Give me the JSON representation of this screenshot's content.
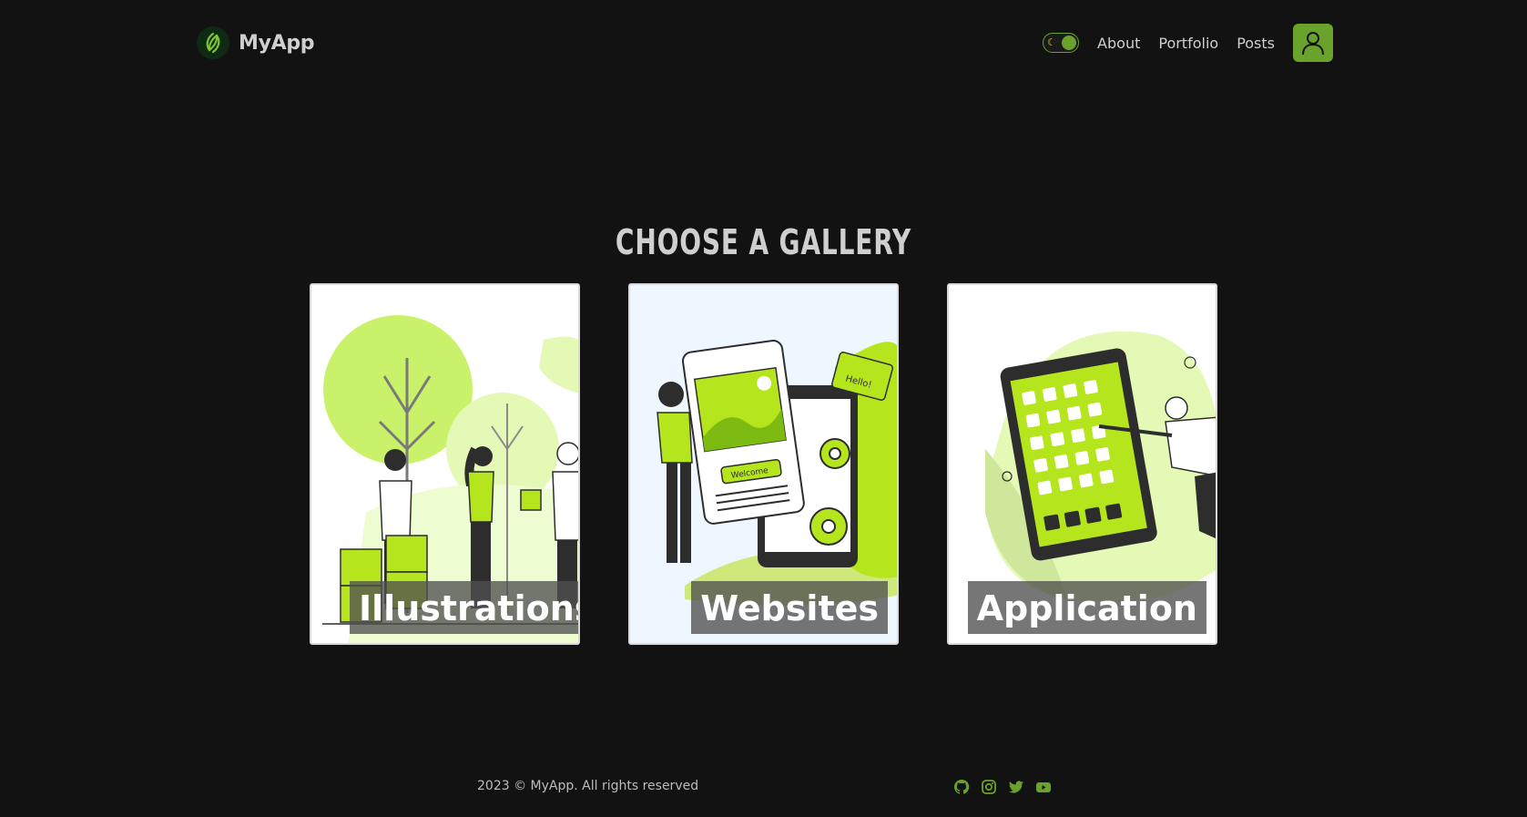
{
  "brand": {
    "name": "MyApp"
  },
  "nav": {
    "theme_toggle_icon": "moon-icon",
    "links": [
      "About",
      "Portfolio",
      "Posts"
    ],
    "user_icon": "user-icon"
  },
  "main": {
    "title": "CHOOSE A GALLERY",
    "cards": [
      {
        "label": "Illustrations",
        "illustration": "people-with-trees-and-boxes"
      },
      {
        "label": "Websites",
        "illustration": "woman-with-phone-and-gears"
      },
      {
        "label": "Application",
        "illustration": "man-tapping-tablet-apps"
      }
    ]
  },
  "footer": {
    "copyright": "2023 © MyApp. All rights reserved",
    "socials": [
      "github-icon",
      "instagram-icon",
      "twitter-icon",
      "youtube-icon"
    ]
  },
  "colors": {
    "background": "#121212",
    "accent": "#6aa32b",
    "lime": "#b5e61d",
    "text": "#cfcfcf"
  }
}
